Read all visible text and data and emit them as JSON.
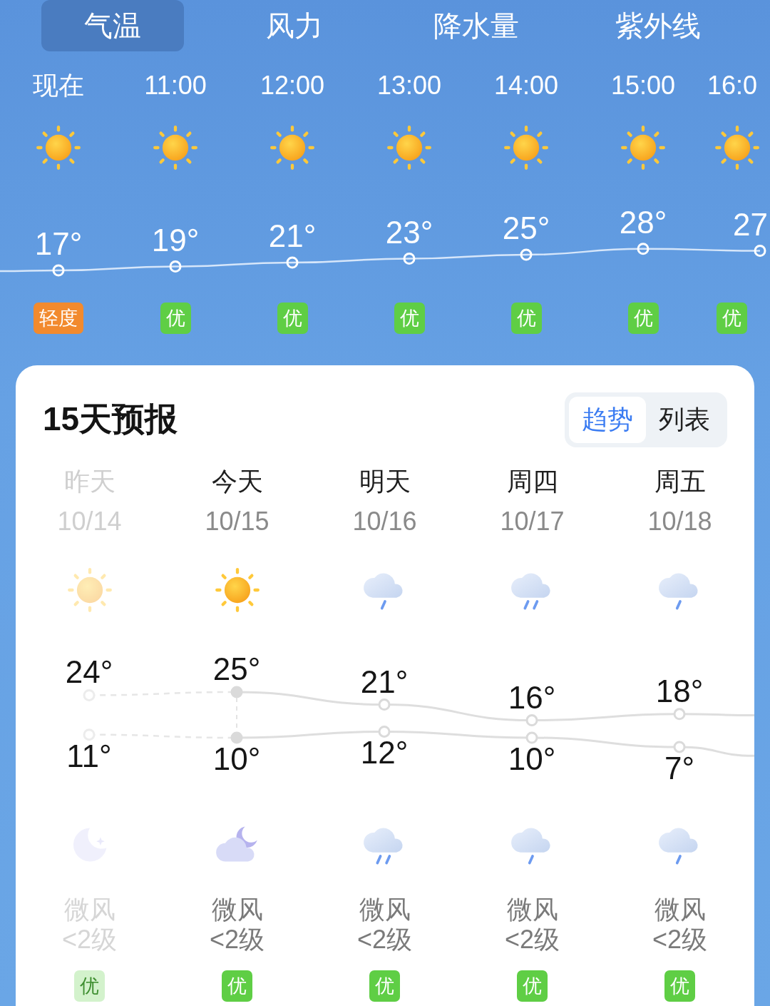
{
  "tabs": [
    {
      "label": "气温",
      "selected": true
    },
    {
      "label": "风力",
      "selected": false
    },
    {
      "label": "降水量",
      "selected": false
    },
    {
      "label": "紫外线",
      "selected": false
    }
  ],
  "hourly": [
    {
      "time": "现在",
      "kind": "sunny",
      "temp": "17°",
      "aqi": {
        "text": "轻度",
        "color": "#f28a2e"
      }
    },
    {
      "time": "11:00",
      "kind": "sunny",
      "temp": "19°",
      "aqi": {
        "text": "优",
        "color": "#5fce45"
      }
    },
    {
      "time": "12:00",
      "kind": "sunny",
      "temp": "21°",
      "aqi": {
        "text": "优",
        "color": "#5fce45"
      }
    },
    {
      "time": "13:00",
      "kind": "sunny",
      "temp": "23°",
      "aqi": {
        "text": "优",
        "color": "#5fce45"
      }
    },
    {
      "time": "14:00",
      "kind": "sunny",
      "temp": "25°",
      "aqi": {
        "text": "优",
        "color": "#5fce45"
      }
    },
    {
      "time": "15:00",
      "kind": "sunny",
      "temp": "28°",
      "aqi": {
        "text": "优",
        "color": "#5fce45"
      }
    },
    {
      "time": "16:0",
      "kind": "sunny",
      "temp": "27",
      "aqi": {
        "text": "优",
        "color": "#5fce45"
      }
    }
  ],
  "forecast": {
    "title": "15天预报",
    "views": [
      {
        "label": "趋势",
        "selected": true
      },
      {
        "label": "列表",
        "selected": false
      }
    ],
    "days": [
      {
        "name": "昨天",
        "date": "10/14",
        "past": true,
        "day_icon": {
          "kind": "sunny"
        },
        "high": "24°",
        "low": "11°",
        "night_icon": {
          "kind": "clear_night"
        },
        "wind": "微风",
        "wind_level": "<2级",
        "aqi": {
          "text": "优",
          "color": "#d3f2cc"
        }
      },
      {
        "name": "今天",
        "date": "10/15",
        "past": false,
        "day_icon": {
          "kind": "sunny"
        },
        "high": "25°",
        "low": "10°",
        "night_icon": {
          "kind": "cloudy_night"
        },
        "wind": "微风",
        "wind_level": "<2级",
        "aqi": {
          "text": "优",
          "color": "#5fce45"
        }
      },
      {
        "name": "明天",
        "date": "10/16",
        "past": false,
        "day_icon": {
          "kind": "light_rain"
        },
        "high": "21°",
        "low": "12°",
        "night_icon": {
          "kind": "moderate_rain"
        },
        "wind": "微风",
        "wind_level": "<2级",
        "aqi": {
          "text": "优",
          "color": "#5fce45"
        }
      },
      {
        "name": "周四",
        "date": "10/17",
        "past": false,
        "day_icon": {
          "kind": "moderate_rain"
        },
        "high": "16°",
        "low": "10°",
        "night_icon": {
          "kind": "light_rain"
        },
        "wind": "微风",
        "wind_level": "<2级",
        "aqi": {
          "text": "优",
          "color": "#5fce45"
        }
      },
      {
        "name": "周五",
        "date": "10/18",
        "past": false,
        "day_icon": {
          "kind": "light_rain"
        },
        "high": "18°",
        "low": "7°",
        "night_icon": {
          "kind": "light_rain"
        },
        "wind": "微风",
        "wind_level": "<2级",
        "aqi": {
          "text": "优",
          "color": "#5fce45"
        }
      }
    ]
  }
}
